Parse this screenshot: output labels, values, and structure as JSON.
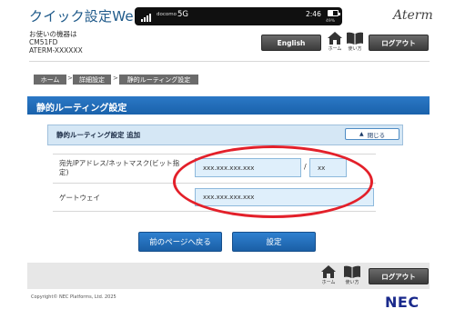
{
  "header": {
    "app_title": "クイック設定Web",
    "device_label": "お使いの機器は",
    "device_model": "CM51FD",
    "device_id": "ATERM-XXXXXX",
    "brand": "Aterm",
    "english_label": "English",
    "home_label": "ホーム",
    "help_label": "使い方",
    "logout_label": "ログアウト"
  },
  "status_bar": {
    "carrier": "docomo",
    "network": "5G",
    "time": "2:46",
    "battery": "49%",
    "battery_level": 0.49
  },
  "breadcrumb": [
    "ホーム",
    "詳細設定",
    "静的ルーティング設定"
  ],
  "breadcrumb_separator": ">",
  "page_title": "静的ルーティング設定",
  "panel": {
    "title": "静的ルーティング設定 追加",
    "close_label": "閉じる"
  },
  "form": {
    "ip_label_line1": "宛先IPアドレス/ネットマスク(ビット指",
    "ip_label_line2": "定)",
    "ip_value": "xxx.xxx.xxx.xxx",
    "separator": "/",
    "mask_value": "xx",
    "gateway_label": "ゲートウェイ",
    "gateway_value": "xxx.xxx.xxx.xxx"
  },
  "actions": {
    "back_label": "前のページへ戻る",
    "submit_label": "設定"
  },
  "footer": {
    "home_label": "ホーム",
    "help_label": "使い方",
    "logout_label": "ログアウト",
    "copyright": "Copyright© NEC Platforms, Ltd. 2025",
    "logo": "NEC"
  },
  "colors": {
    "accent_blue": "#1a62ab",
    "panel_bg": "#d5e7f5",
    "field_bg": "#dfeffb",
    "highlight": "#e3202a"
  }
}
